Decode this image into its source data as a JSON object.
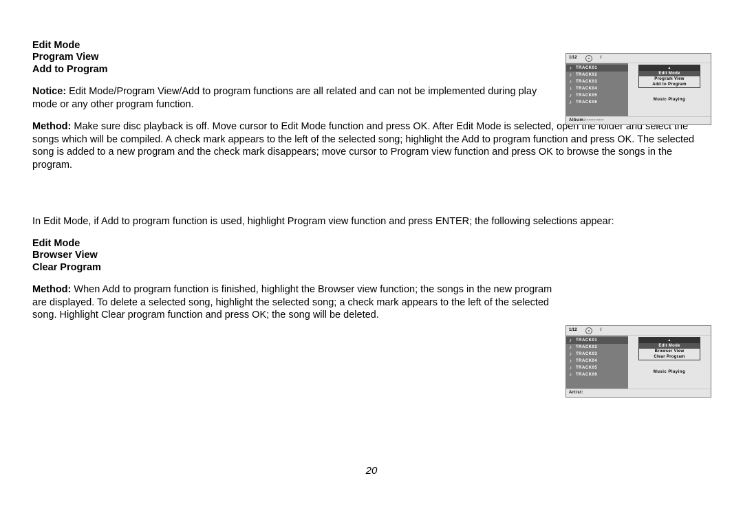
{
  "section1": {
    "heading1": "Edit Mode",
    "heading2": "Program View",
    "heading3": "Add to Program",
    "notice_label": "Notice:",
    "notice_text": " Edit Mode/Program View/Add to program functions are all related and can not be implemented during play mode or any other program function.",
    "method_label": "Method:",
    "method_text": " Make sure disc playback is off. Move cursor to Edit Mode function and press OK. After Edit Mode is selected, open the folder and select the songs which will be compiled. A check mark appears to the left of the selected song; highlight the  Add to program function and press OK. The selected song is added to a new program and the check mark disappears; move cursor to Program view  function and press OK to browse the songs in the program.",
    "bridge_text": "In Edit Mode, if Add to program function is used, highlight Program view function and press ENTER; the following selections appear:"
  },
  "section2": {
    "heading1": "Edit Mode",
    "heading2": "Browser View",
    "heading3": "Clear Program",
    "method_label": "Method:",
    "method_text": " When Add to program function is finished, highlight the Browser view function; the songs in the new program are displayed. To delete a selected song, highlight the selected song; a check mark appears to the left of the selected song. Highlight  Clear program function and press OK; the song will be deleted."
  },
  "page_number": "20",
  "fig1": {
    "header_left": "1/12",
    "header_right": "/",
    "tracks": [
      "TRACK01",
      "TRACK02",
      "TRACK03",
      "TRACK04",
      "TRACK05",
      "TRACK06"
    ],
    "menu": [
      "Edit  Mode",
      "Program  View",
      "Add  to  Program"
    ],
    "selected_menu_index": 0,
    "status": "Music Playing",
    "footer": "Album:-----------"
  },
  "fig2": {
    "header_left": "1/12",
    "header_right": "/",
    "tracks": [
      "TRACK01",
      "TRACK02",
      "TRACK03",
      "TRACK04",
      "TRACK05",
      "TRACK06"
    ],
    "menu": [
      "Edit  Mode",
      "Browser  View",
      "Clear  Program"
    ],
    "selected_menu_index": 0,
    "status": "Music Playing",
    "footer": "Artist:"
  }
}
